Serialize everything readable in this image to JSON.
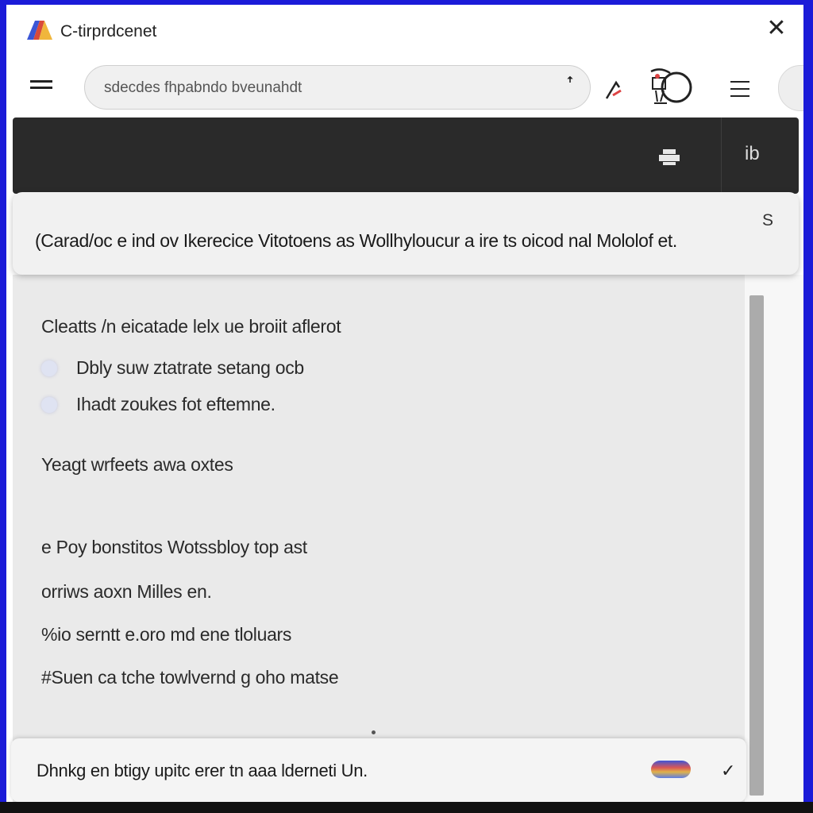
{
  "window": {
    "title": "C-tirprdcenet",
    "close_glyph": "✕"
  },
  "toolbar": {
    "search_placeholder": "sdecdes fhpabndo bveunahdt",
    "search_caret": "ꜛ"
  },
  "dark_bar": {
    "icon_label": "ib"
  },
  "notice": {
    "text": "(Carad/oc e ind ov Ikerecice Vitotoens as Wollhyloucur a ire ts oicod nal Mololof et.",
    "badge": "S"
  },
  "panel": {
    "heading": "Cleatts /n eicatade lelx ue broiit aflerot",
    "options": [
      "Dbly suw ztatrate setang ocb",
      "Ihadt zoukes fot eftemne."
    ],
    "lines": [
      "Yeagt wrfeets awa oxtes",
      "e Poy bonstitos Wotssbloy top ast",
      "orriws aoxn Milles en.",
      "%io serntt e.oro md ene tloluars",
      "#Suen ca tche towlvernd g oho matse"
    ]
  },
  "bottom_bar": {
    "text": "Dhnkg en btigy upitc erer tn aaa lderneti Un.",
    "check_glyph": "✓"
  },
  "colors": {
    "frame_border": "#1b1bd8",
    "dark_bar": "#2a2a2a",
    "panel_bg": "#eaeaea"
  }
}
